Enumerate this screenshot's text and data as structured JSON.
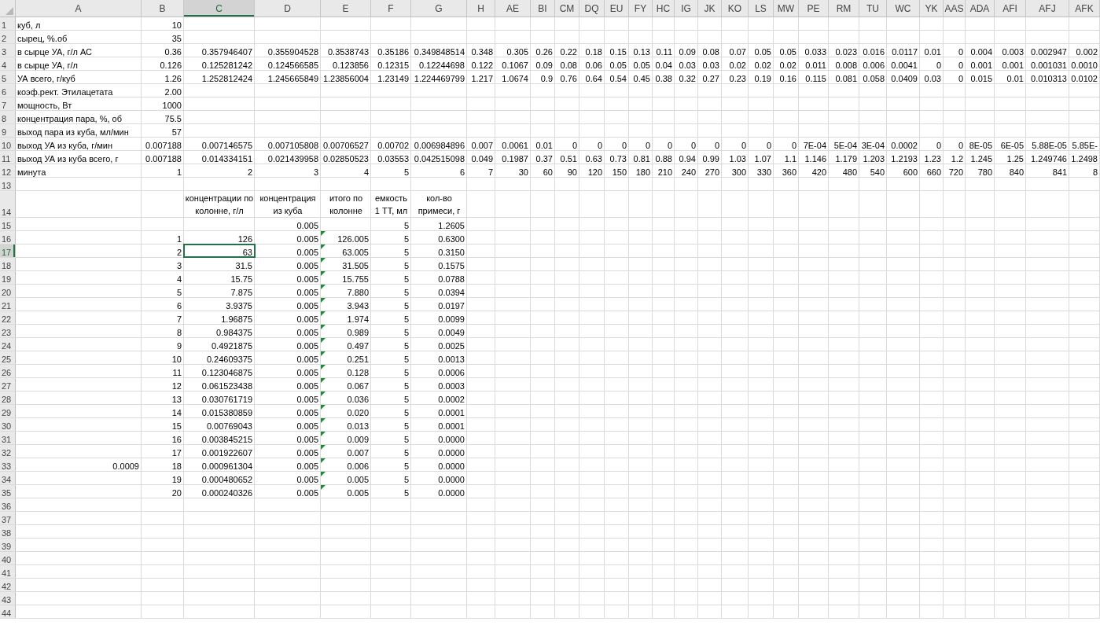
{
  "columns": [
    {
      "label": "A",
      "kind": "text",
      "selected": false
    },
    {
      "label": "B",
      "kind": "number",
      "selected": false
    },
    {
      "label": "C",
      "kind": "number",
      "selected": true
    },
    {
      "label": "D",
      "kind": "number",
      "selected": false
    },
    {
      "label": "E",
      "kind": "number",
      "selected": false
    },
    {
      "label": "F",
      "kind": "number",
      "selected": false
    },
    {
      "label": "G",
      "kind": "number",
      "selected": false
    },
    {
      "label": "H",
      "kind": "number",
      "selected": false
    },
    {
      "label": "AE",
      "kind": "number",
      "selected": false
    },
    {
      "label": "BI",
      "kind": "number",
      "selected": false
    },
    {
      "label": "CM",
      "kind": "number",
      "selected": false
    },
    {
      "label": "DQ",
      "kind": "number",
      "selected": false
    },
    {
      "label": "EU",
      "kind": "number",
      "selected": false
    },
    {
      "label": "FY",
      "kind": "number",
      "selected": false
    },
    {
      "label": "HC",
      "kind": "number",
      "selected": false
    },
    {
      "label": "IG",
      "kind": "number",
      "selected": false
    },
    {
      "label": "JK",
      "kind": "number",
      "selected": false
    },
    {
      "label": "KO",
      "kind": "number",
      "selected": false
    },
    {
      "label": "LS",
      "kind": "number",
      "selected": false
    },
    {
      "label": "MW",
      "kind": "number",
      "selected": false
    },
    {
      "label": "PE",
      "kind": "number",
      "selected": false
    },
    {
      "label": "RM",
      "kind": "number",
      "selected": false
    },
    {
      "label": "TU",
      "kind": "number",
      "selected": false
    },
    {
      "label": "WC",
      "kind": "number",
      "selected": false
    },
    {
      "label": "YK",
      "kind": "number",
      "selected": false
    },
    {
      "label": "AAS",
      "kind": "number",
      "selected": false
    },
    {
      "label": "ADA",
      "kind": "number",
      "selected": false
    },
    {
      "label": "AFI",
      "kind": "number",
      "selected": false
    },
    {
      "label": "AFJ",
      "kind": "number",
      "selected": false
    },
    {
      "label": "AFK",
      "kind": "number",
      "selected": false
    }
  ],
  "rows": [
    {
      "number": "1",
      "selected": false,
      "cells": [
        "куб, л",
        "10"
      ]
    },
    {
      "number": "2",
      "selected": false,
      "cells": [
        "сырец, %.об",
        "35"
      ]
    },
    {
      "number": "3",
      "selected": false,
      "cells": [
        "в сырце УА, г/л АС",
        "0.36",
        "0.357946407",
        "0.355904528",
        "0.3538743",
        "0.35186",
        "0.349848514",
        "0.348",
        "0.305",
        "0.26",
        "0.22",
        "0.18",
        "0.15",
        "0.13",
        "0.11",
        "0.09",
        "0.08",
        "0.07",
        "0.05",
        "0.05",
        "0.033",
        "0.023",
        "0.016",
        "0.0117",
        "0.01",
        "0",
        "0.004",
        "0.003",
        "0.002947",
        "0.002"
      ]
    },
    {
      "number": "4",
      "selected": false,
      "cells": [
        "в сырце УА, г/л",
        "0.126",
        "0.125281242",
        "0.124566585",
        "0.123856",
        "0.12315",
        "0.12244698",
        "0.122",
        "0.1067",
        "0.09",
        "0.08",
        "0.06",
        "0.05",
        "0.05",
        "0.04",
        "0.03",
        "0.03",
        "0.02",
        "0.02",
        "0.02",
        "0.011",
        "0.008",
        "0.006",
        "0.0041",
        "0",
        "0",
        "0.001",
        "0.001",
        "0.001031",
        "0.0010"
      ]
    },
    {
      "number": "5",
      "selected": false,
      "cells": [
        "УА всего, г/куб",
        "1.26",
        "1.252812424",
        "1.245665849",
        "1.23856004",
        "1.23149",
        "1.224469799",
        "1.217",
        "1.0674",
        "0.9",
        "0.76",
        "0.64",
        "0.54",
        "0.45",
        "0.38",
        "0.32",
        "0.27",
        "0.23",
        "0.19",
        "0.16",
        "0.115",
        "0.081",
        "0.058",
        "0.0409",
        "0.03",
        "0",
        "0.015",
        "0.01",
        "0.010313",
        "0.0102"
      ]
    },
    {
      "number": "6",
      "selected": false,
      "cells": [
        "коэф.рект. Этилацетата",
        "2.00"
      ]
    },
    {
      "number": "7",
      "selected": false,
      "cells": [
        "мощность, Вт",
        "1000"
      ]
    },
    {
      "number": "8",
      "selected": false,
      "cells": [
        "концентрация пара, %, об",
        "75.5"
      ]
    },
    {
      "number": "9",
      "selected": false,
      "cells": [
        "выход пара из куба, мл/мин",
        "57"
      ]
    },
    {
      "number": "10",
      "selected": false,
      "cells": [
        "выход УА из куба, г/мин",
        "0.007188",
        "0.007146575",
        "0.007105808",
        "0.00706527",
        "0.00702",
        "0.006984896",
        "0.007",
        "0.0061",
        "0.01",
        "0",
        "0",
        "0",
        "0",
        "0",
        "0",
        "0",
        "0",
        "0",
        "0",
        "7E-04",
        "5E-04",
        "3E-04",
        "0.0002",
        "0",
        "0",
        "8E-05",
        "6E-05",
        "5.88E-05",
        "5.85E-"
      ]
    },
    {
      "number": "11",
      "selected": false,
      "cells": [
        "выход УА из куба всего, г",
        "0.007188",
        "0.014334151",
        "0.021439958",
        "0.02850523",
        "0.03553",
        "0.042515098",
        "0.049",
        "0.1987",
        "0.37",
        "0.51",
        "0.63",
        "0.73",
        "0.81",
        "0.88",
        "0.94",
        "0.99",
        "1.03",
        "1.07",
        "1.1",
        "1.146",
        "1.179",
        "1.203",
        "1.2193",
        "1.23",
        "1.2",
        "1.245",
        "1.25",
        "1.249746",
        "1.2498"
      ]
    },
    {
      "number": "12",
      "selected": false,
      "cells": [
        "минута",
        "1",
        "2",
        "3",
        "4",
        "5",
        "6",
        "7",
        "30",
        "60",
        "90",
        "120",
        "150",
        "180",
        "210",
        "240",
        "270",
        "300",
        "330",
        "360",
        "420",
        "480",
        "540",
        "600",
        "660",
        "720",
        "780",
        "840",
        "841",
        "8"
      ]
    },
    {
      "number": "13",
      "selected": false
    },
    {
      "number": "14",
      "selected": false,
      "kind": "header",
      "cells": [
        null,
        null,
        "концентрации по колонне, г/л",
        "концентрация из куба",
        "итого по колонне",
        "емкость 1 ТТ, мл",
        "кол-во примеси, г"
      ]
    },
    {
      "number": "15",
      "selected": false,
      "cells": [
        null,
        null,
        null,
        "0.005",
        null,
        "5",
        "1.2605"
      ]
    },
    {
      "number": "16",
      "selected": false,
      "cells": [
        null,
        "1",
        "126",
        "0.005",
        {
          "value": "126.005",
          "flag": true
        },
        "5",
        "0.6300"
      ]
    },
    {
      "number": "17",
      "selected": true,
      "cells": [
        null,
        "2",
        "63",
        "0.005",
        {
          "value": "63.005",
          "flag": true
        },
        "5",
        "0.3150"
      ]
    },
    {
      "number": "18",
      "selected": false,
      "cells": [
        null,
        "3",
        "31.5",
        "0.005",
        {
          "value": "31.505",
          "flag": true
        },
        "5",
        "0.1575"
      ]
    },
    {
      "number": "19",
      "selected": false,
      "cells": [
        null,
        "4",
        "15.75",
        "0.005",
        {
          "value": "15.755",
          "flag": true
        },
        "5",
        "0.0788"
      ]
    },
    {
      "number": "20",
      "selected": false,
      "cells": [
        null,
        "5",
        "7.875",
        "0.005",
        {
          "value": "7.880",
          "flag": true
        },
        "5",
        "0.0394"
      ]
    },
    {
      "number": "21",
      "selected": false,
      "cells": [
        null,
        "6",
        "3.9375",
        "0.005",
        {
          "value": "3.943",
          "flag": true
        },
        "5",
        "0.0197"
      ]
    },
    {
      "number": "22",
      "selected": false,
      "cells": [
        null,
        "7",
        "1.96875",
        "0.005",
        {
          "value": "1.974",
          "flag": true
        },
        "5",
        "0.0099"
      ]
    },
    {
      "number": "23",
      "selected": false,
      "cells": [
        null,
        "8",
        "0.984375",
        "0.005",
        {
          "value": "0.989",
          "flag": true
        },
        "5",
        "0.0049"
      ]
    },
    {
      "number": "24",
      "selected": false,
      "cells": [
        null,
        "9",
        "0.4921875",
        "0.005",
        {
          "value": "0.497",
          "flag": true
        },
        "5",
        "0.0025"
      ]
    },
    {
      "number": "25",
      "selected": false,
      "cells": [
        null,
        "10",
        "0.24609375",
        "0.005",
        {
          "value": "0.251",
          "flag": true
        },
        "5",
        "0.0013"
      ]
    },
    {
      "number": "26",
      "selected": false,
      "cells": [
        null,
        "11",
        "0.123046875",
        "0.005",
        {
          "value": "0.128",
          "flag": true
        },
        "5",
        "0.0006"
      ]
    },
    {
      "number": "27",
      "selected": false,
      "cells": [
        null,
        "12",
        "0.061523438",
        "0.005",
        {
          "value": "0.067",
          "flag": true
        },
        "5",
        "0.0003"
      ]
    },
    {
      "number": "28",
      "selected": false,
      "cells": [
        null,
        "13",
        "0.030761719",
        "0.005",
        {
          "value": "0.036",
          "flag": true
        },
        "5",
        "0.0002"
      ]
    },
    {
      "number": "29",
      "selected": false,
      "cells": [
        null,
        "14",
        "0.015380859",
        "0.005",
        {
          "value": "0.020",
          "flag": true
        },
        "5",
        "0.0001"
      ]
    },
    {
      "number": "30",
      "selected": false,
      "cells": [
        null,
        "15",
        "0.00769043",
        "0.005",
        {
          "value": "0.013",
          "flag": true
        },
        "5",
        "0.0001"
      ]
    },
    {
      "number": "31",
      "selected": false,
      "cells": [
        null,
        "16",
        "0.003845215",
        "0.005",
        {
          "value": "0.009",
          "flag": true
        },
        "5",
        "0.0000"
      ]
    },
    {
      "number": "32",
      "selected": false,
      "cells": [
        null,
        "17",
        "0.001922607",
        "0.005",
        {
          "value": "0.007",
          "flag": true
        },
        "5",
        "0.0000"
      ]
    },
    {
      "number": "33",
      "selected": false,
      "cells": [
        {
          "value": "0.0009",
          "kind": "number"
        },
        "18",
        "0.000961304",
        "0.005",
        {
          "value": "0.006",
          "flag": true
        },
        "5",
        "0.0000"
      ]
    },
    {
      "number": "34",
      "selected": false,
      "cells": [
        null,
        "19",
        "0.000480652",
        "0.005",
        {
          "value": "0.005",
          "flag": true
        },
        "5",
        "0.0000"
      ]
    },
    {
      "number": "35",
      "selected": false,
      "cells": [
        null,
        "20",
        "0.000240326",
        "0.005",
        {
          "value": "0.005",
          "flag": true
        },
        "5",
        "0.0000"
      ]
    },
    {
      "number": "36",
      "selected": false
    },
    {
      "number": "37",
      "selected": false
    },
    {
      "number": "38",
      "selected": false
    },
    {
      "number": "39",
      "selected": false
    },
    {
      "number": "40",
      "selected": false
    },
    {
      "number": "41",
      "selected": false
    },
    {
      "number": "42",
      "selected": false
    },
    {
      "number": "43",
      "selected": false
    },
    {
      "number": "44",
      "selected": false
    }
  ]
}
